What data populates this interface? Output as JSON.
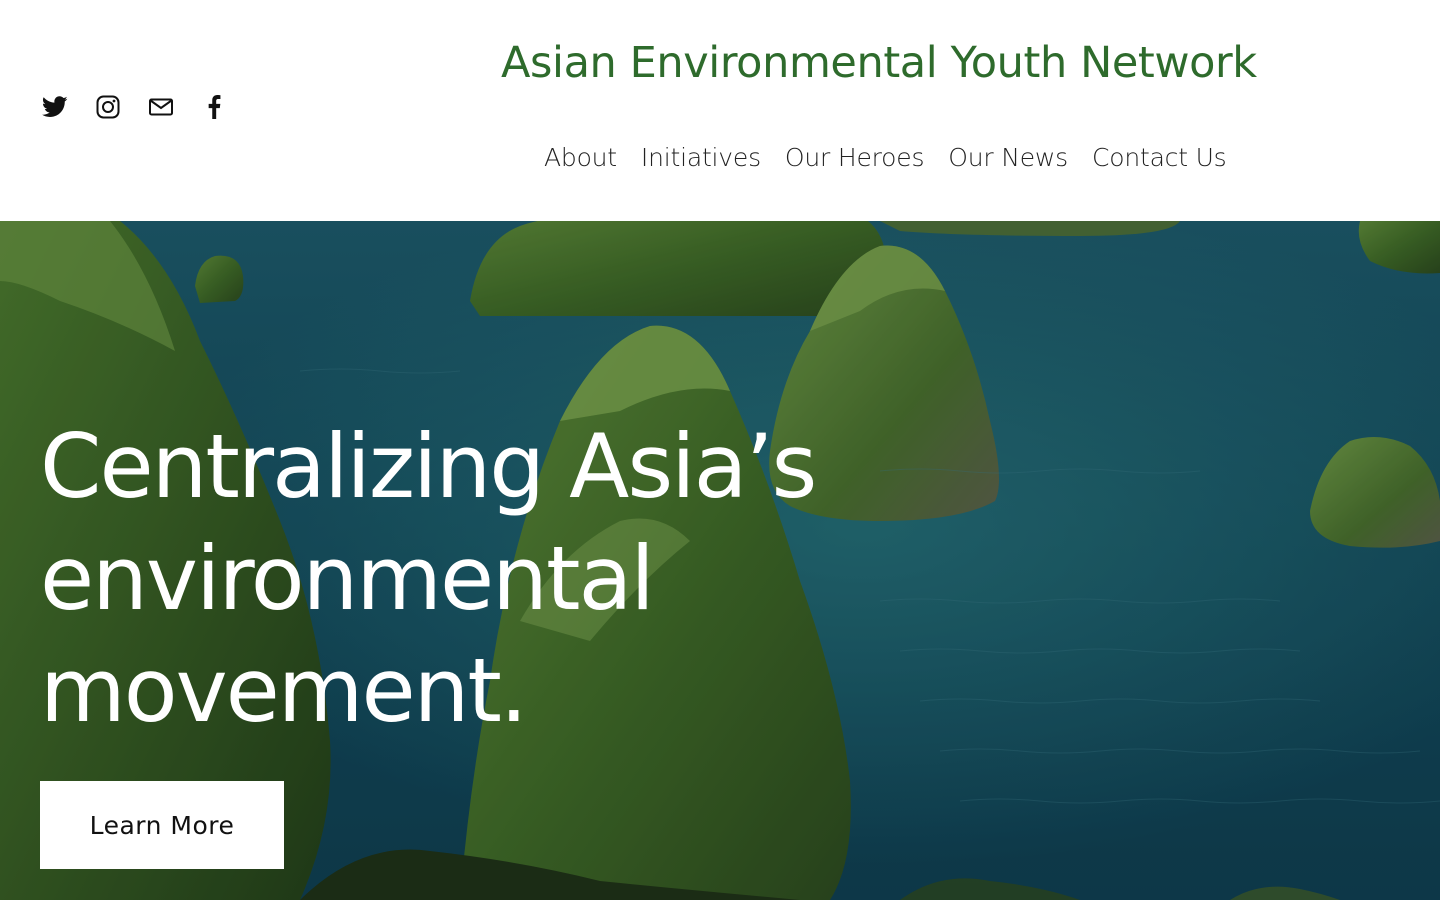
{
  "header": {
    "site_title": "Asian Environmental Youth Network",
    "title_color": "#2e6b2c",
    "social": [
      {
        "name": "twitter-icon"
      },
      {
        "name": "instagram-icon"
      },
      {
        "name": "email-icon"
      },
      {
        "name": "facebook-icon"
      }
    ],
    "nav": [
      "About",
      "Initiatives",
      "Our Heroes",
      "Our News",
      "Contact Us"
    ]
  },
  "hero": {
    "heading_lines": [
      "Centralizing Asia’s",
      "environmental",
      "movement."
    ],
    "cta_label": "Learn More"
  }
}
